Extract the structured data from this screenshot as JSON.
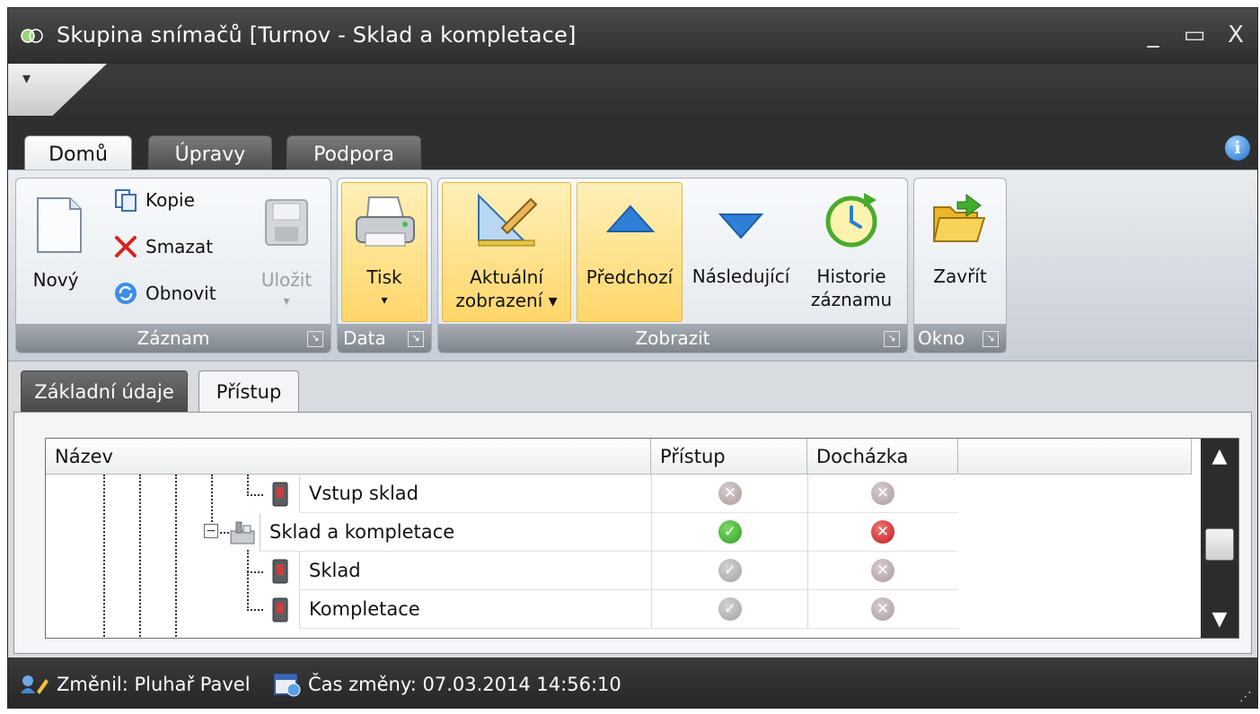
{
  "window": {
    "title": "Skupina snímačů [Turnov - Sklad a kompletace]",
    "minimize": "_",
    "maximize": "▭",
    "close": "X"
  },
  "qat": {
    "arrow": "▾"
  },
  "ribbon_tabs": [
    {
      "label": "Domů",
      "active": true
    },
    {
      "label": "Úpravy",
      "active": false
    },
    {
      "label": "Podpora",
      "active": false
    }
  ],
  "ribbon": {
    "groups": {
      "zaznam": {
        "label": "Záznam",
        "new_label": "Nový",
        "copy_label": "Kopie",
        "delete_label": "Smazat",
        "refresh_label": "Obnovit",
        "save_label": "Uložit",
        "save_arrow": "▾"
      },
      "data": {
        "label": "Data",
        "print_label": "Tisk",
        "print_arrow": "▾"
      },
      "zobrazit": {
        "label": "Zobrazit",
        "current_view_line1": "Aktuální",
        "current_view_line2": "zobrazení ▾",
        "previous_label": "Předchozí",
        "next_label": "Následující",
        "history_line1": "Historie",
        "history_line2": "záznamu"
      },
      "okno": {
        "label": "Okno",
        "close_label": "Zavřít"
      }
    },
    "launcher_glyph": "↘"
  },
  "page_tabs": [
    {
      "label": "Základní údaje",
      "active": false
    },
    {
      "label": "Přístup",
      "active": true
    }
  ],
  "grid": {
    "columns": [
      "Název",
      "Přístup",
      "Docházka"
    ],
    "rows": [
      {
        "name": "Vstup sklad",
        "pristup": "disabled-deny",
        "dochazka": "disabled-deny"
      },
      {
        "name": "Sklad a kompletace",
        "pristup": "allow",
        "dochazka": "deny"
      },
      {
        "name": "Sklad",
        "pristup": "disabled-allow",
        "dochazka": "disabled-deny"
      },
      {
        "name": "Kompletace",
        "pristup": "disabled-allow",
        "dochazka": "disabled-deny"
      }
    ],
    "tree_toggle": "⊖"
  },
  "statusbar": {
    "changed_by": "Změnil: Pluhař Pavel",
    "changed_time": "Čas změny: 07.03.2014 14:56:10"
  },
  "colors": {
    "allow": "#2f9b24",
    "deny": "#c2151b",
    "highlight": "#ffd66a"
  }
}
